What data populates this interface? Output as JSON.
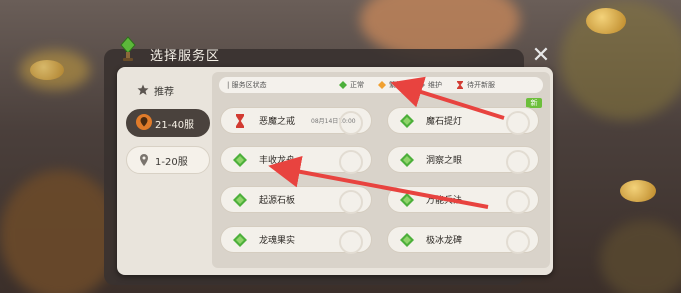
{
  "dialog": {
    "title": "选择服务区",
    "close_icon": "close-icon",
    "colors": {
      "accent": "#e8433f",
      "active_tab": "#4a423d",
      "normal_status": "#4caf3a",
      "busy_status": "#f0a030",
      "new_badge": "#6cbf3b"
    }
  },
  "tabs": [
    {
      "label": "推荐",
      "icon": "star-icon",
      "active": false
    },
    {
      "label": "21-40服",
      "icon": "location-pin-icon",
      "active": true
    },
    {
      "label": "1-20服",
      "icon": "location-pin-icon",
      "active": false
    }
  ],
  "legend": {
    "title": "服务区状态",
    "items": [
      {
        "label": "正常",
        "color": "#4caf3a"
      },
      {
        "label": "繁忙",
        "color": "#f0a030"
      },
      {
        "label": "维护",
        "color": "#8a8a8a"
      },
      {
        "label": "待开新服",
        "color": "#d23b32"
      }
    ]
  },
  "new_badge": "新",
  "servers": [
    {
      "name": "恶魔之戒",
      "status": "upcoming",
      "date": "08月14日10:00"
    },
    {
      "name": "魔石提灯",
      "status": "normal"
    },
    {
      "name": "丰收龙舟",
      "status": "normal"
    },
    {
      "name": "洞察之眼",
      "status": "normal"
    },
    {
      "name": "起源石板",
      "status": "normal"
    },
    {
      "name": "万能兵法",
      "status": "normal"
    },
    {
      "name": "龙魂果实",
      "status": "normal"
    },
    {
      "name": "极冰龙碑",
      "status": "normal"
    }
  ]
}
